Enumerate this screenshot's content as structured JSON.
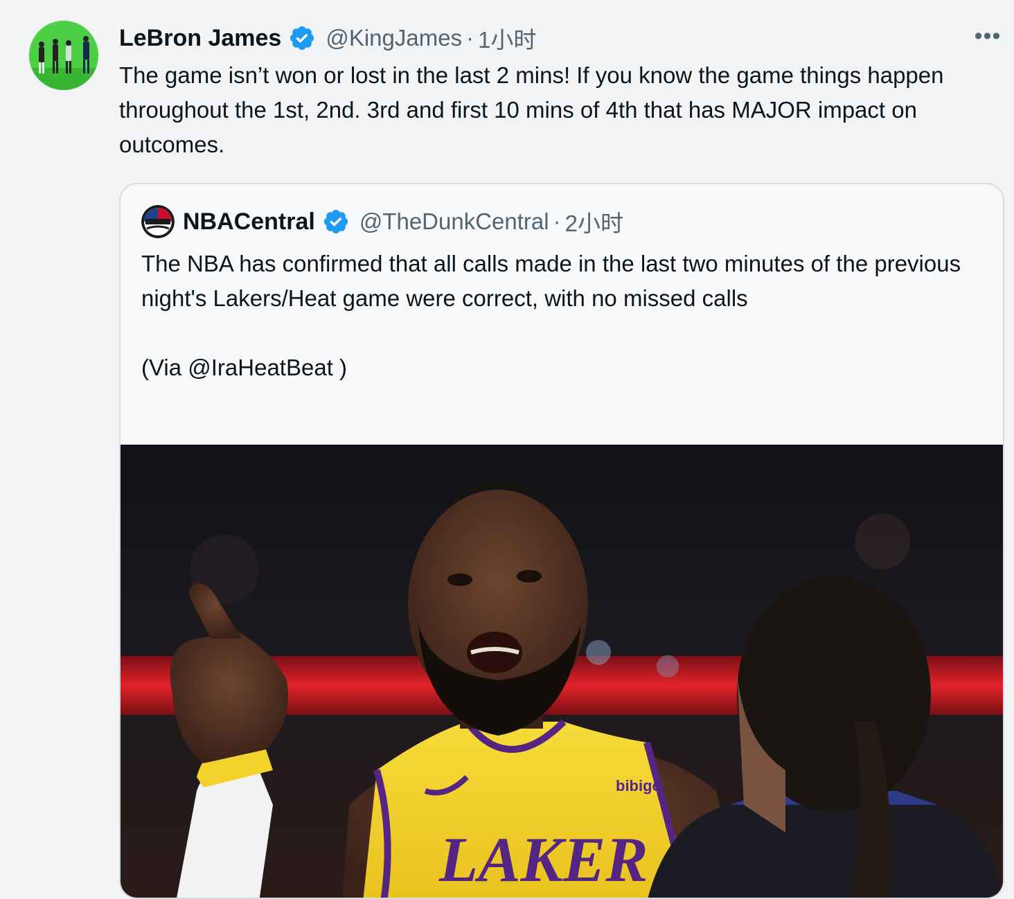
{
  "tweet": {
    "author_name": "LeBron James",
    "handle": "@KingJames",
    "separator": "·",
    "time": "1小时",
    "text": "The game isn’t won or lost in the last 2 mins! If you know the game things happen throughout the 1st, 2nd. 3rd and first 10 mins of 4th that has MAJOR impact on outcomes.",
    "more_label": "•••"
  },
  "quoted_tweet": {
    "author_name": "NBACentral",
    "handle": "@TheDunkCentral",
    "separator": "·",
    "time": "2小时",
    "text": "The NBA has confirmed that all calls made in the last two minutes of the previous night's Lakers/Heat game were correct, with no missed calls\n\n(Via @IraHeatBeat )",
    "media": {
      "description": "LeBron James in Lakers jersey pointing and talking to a referee",
      "jersey_text": "LAKERS",
      "sponsor_text": "bibigo"
    }
  },
  "colors": {
    "verified": "#1d9bf0",
    "text_primary": "#0f1419",
    "text_secondary": "#536471",
    "jersey_yellow": "#f3d22b",
    "jersey_purple": "#552583"
  },
  "icons": [
    "verified-badge-icon",
    "more-options-icon"
  ]
}
